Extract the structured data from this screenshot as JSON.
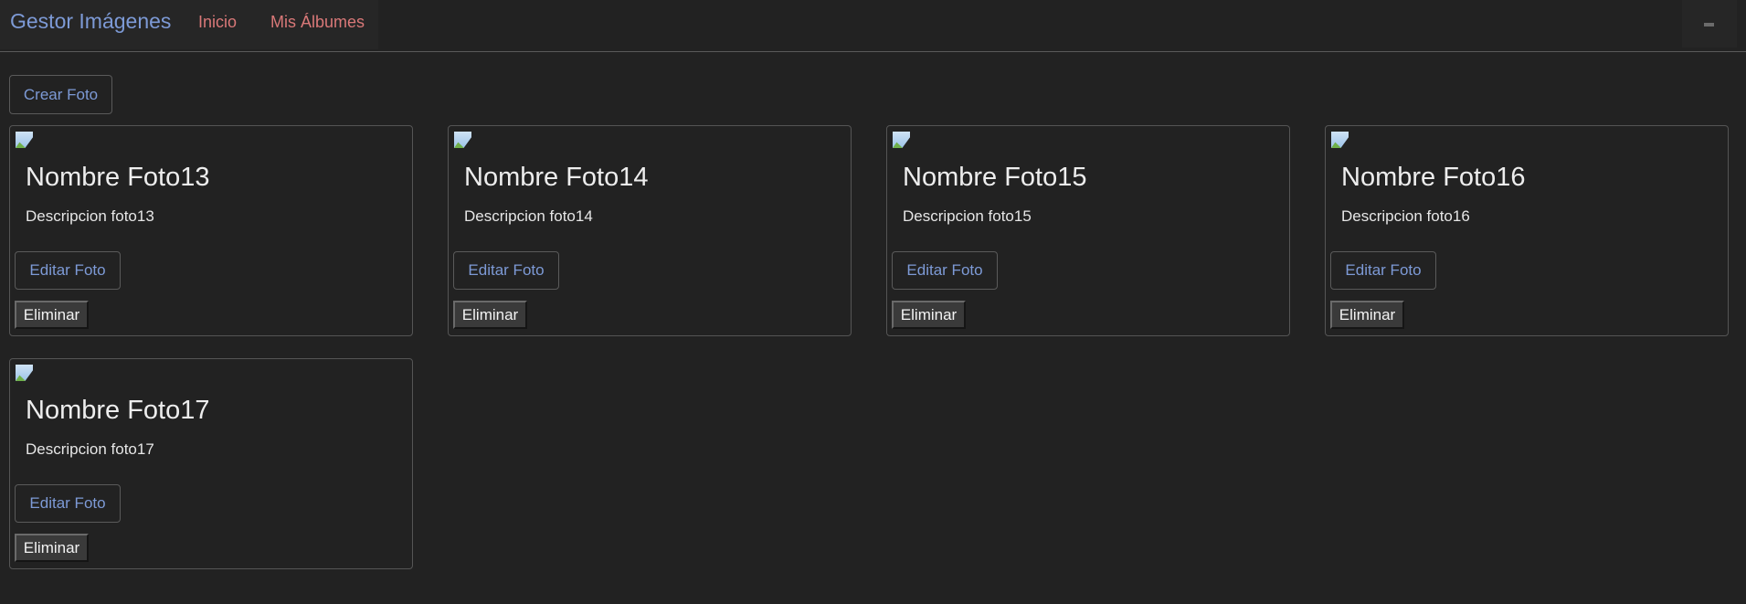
{
  "navbar": {
    "brand": "Gestor Imágenes",
    "links": [
      "Inicio",
      "Mis Álbumes"
    ]
  },
  "toolbar": {
    "create_label": "Crear Foto"
  },
  "photos": [
    {
      "title": "Nombre Foto13",
      "description": "Descripcion foto13",
      "edit_label": "Editar Foto",
      "delete_label": "Eliminar"
    },
    {
      "title": "Nombre Foto14",
      "description": "Descripcion foto14",
      "edit_label": "Editar Foto",
      "delete_label": "Eliminar"
    },
    {
      "title": "Nombre Foto15",
      "description": "Descripcion foto15",
      "edit_label": "Editar Foto",
      "delete_label": "Eliminar"
    },
    {
      "title": "Nombre Foto16",
      "description": "Descripcion foto16",
      "edit_label": "Editar Foto",
      "delete_label": "Eliminar"
    },
    {
      "title": "Nombre Foto17",
      "description": "Descripcion foto17",
      "edit_label": "Editar Foto",
      "delete_label": "Eliminar"
    }
  ],
  "colors": {
    "background": "#222222",
    "brand": "#7d9ad6",
    "nav_link": "#d97878",
    "border": "#555555"
  },
  "icons": {
    "broken_image": "broken-image-icon",
    "toggler": "menu-toggler-icon"
  }
}
